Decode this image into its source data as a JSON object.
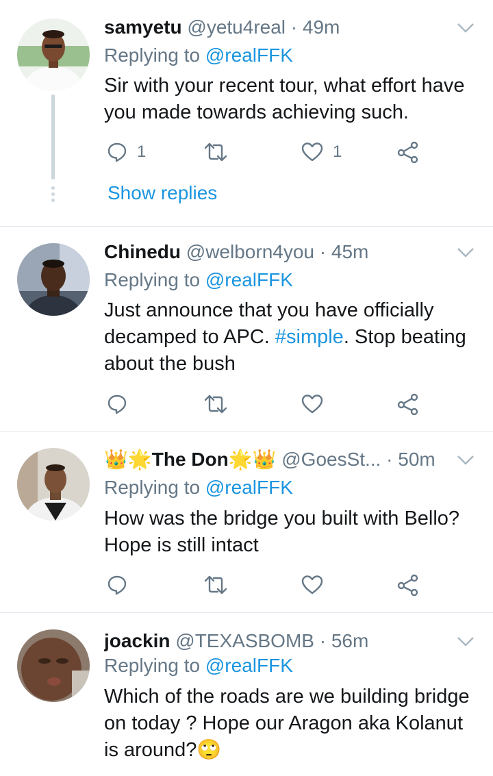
{
  "tweets": [
    {
      "name": "samyetu",
      "handle": "@yetu4real",
      "dot": "·",
      "time": "49m",
      "replying_prefix": "Replying to ",
      "replying_to": "@realFFK",
      "text": "Sir with your recent tour, what effort have you made towards achieving such.",
      "reply_count": "1",
      "like_count": "1",
      "show_replies": "Show replies"
    },
    {
      "name": "Chinedu",
      "handle": "@welborn4you",
      "dot": "·",
      "time": "45m",
      "replying_prefix": "Replying to ",
      "replying_to": "@realFFK",
      "text_before": "Just announce that you have officially decamped to APC. ",
      "hashtag": "#simple",
      "text_after": ". Stop beating about the bush"
    },
    {
      "name": "The Don",
      "name_emoji_left": "👑🌟",
      "name_emoji_right": "🌟👑",
      "handle": "@GoesSt...",
      "dot": "·",
      "time": "50m",
      "replying_prefix": "Replying to ",
      "replying_to": "@realFFK",
      "text": "How was the bridge you built with Bello? Hope is still intact"
    },
    {
      "name": "joackin",
      "handle": "@TEXASBOMB",
      "dot": "·",
      "time": "56m",
      "replying_prefix": "Replying to ",
      "replying_to": "@realFFK",
      "text": "Which of the roads are we building bridge on today ? Hope our Aragon aka Kolanut is around?🙄"
    }
  ],
  "icons": {
    "reply": "reply-icon",
    "retweet": "retweet-icon",
    "like": "heart-icon",
    "share": "share-icon",
    "menu": "chevron-down-icon"
  },
  "colors": {
    "link": "#1b95e0",
    "muted": "#657786",
    "divider": "#e1e8ed"
  }
}
